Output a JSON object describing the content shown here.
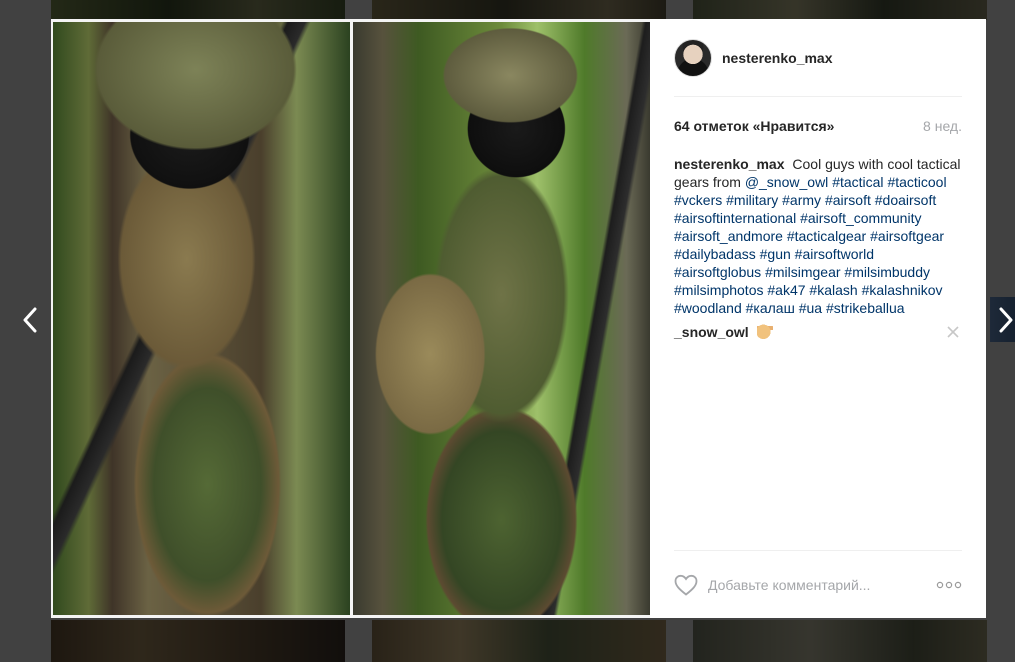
{
  "post": {
    "username": "nesterenko_max",
    "likes_text": "64 отметок «Нравится»",
    "age": "8 нед.",
    "caption_user": "nesterenko_max",
    "caption_text": "Cool guys with cool tactical gears from",
    "mention": "@_snow_owl",
    "hashtags": [
      "#tactical",
      "#tacticool",
      "#vckers",
      "#military",
      "#army",
      "#airsoft",
      "#doairsoft",
      "#airsoftinternational",
      "#airsoft_community",
      "#airsoft_andmore",
      "#tacticalgear",
      "#airsoftgear",
      "#dailybadass",
      "#gun",
      "#airsoftworld",
      "#airsoftglobus",
      "#milsimgear",
      "#milsimbuddy",
      "#milsimphotos",
      "#ak47",
      "#kalash",
      "#kalashnikov",
      "#woodland",
      "#калаш",
      "#ua",
      "#strikeballua"
    ],
    "comment": {
      "username": "_snow_owl",
      "emoji": "thumbs-up"
    }
  },
  "footer": {
    "comment_placeholder": "Добавьте комментарий..."
  },
  "icons": {
    "prev": "chevron-left-icon",
    "next": "chevron-right-icon",
    "like": "heart-icon",
    "delete": "close-icon",
    "more": "more-icon"
  },
  "colors": {
    "link": "#003569",
    "text": "#262626",
    "muted": "#a5a7aa",
    "overlay": "#3f3f3f"
  }
}
